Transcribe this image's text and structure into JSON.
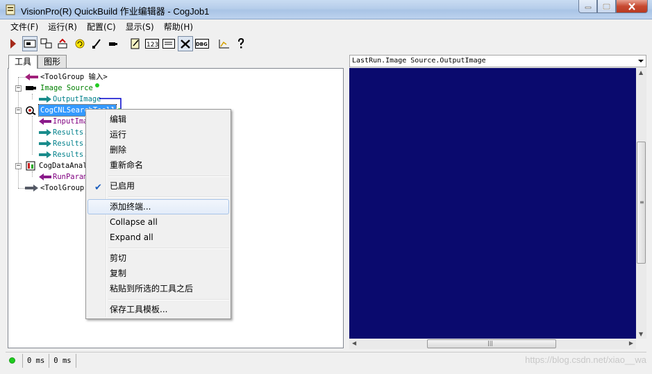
{
  "window": {
    "title": "VisionPro(R) QuickBuild 作业编辑器 - CogJob1"
  },
  "menu": [
    "文件(F)",
    "运行(R)",
    "配置(C)",
    "显示(S)",
    "帮助(H)"
  ],
  "toolbar": {
    "icons": [
      "run-icon",
      "show-display-icon",
      "swap-icon",
      "reset-icon",
      "loop-icon",
      "brush-icon",
      "camera-icon",
      "edit-icon",
      "numbers-icon",
      "image-icon",
      "tools-icon",
      "debug-icon",
      "graph-icon",
      "help-icon"
    ],
    "btn_123": "123",
    "btn_dbg": "DBG"
  },
  "tabs": [
    "工具",
    "图形"
  ],
  "tree": {
    "toolgroup_in": "<ToolGroup 输入>",
    "image_source": "Image Source",
    "output_image": "OutputImage",
    "cnl_search": "CogCNLSearchTool1",
    "input_image": "InputImage",
    "results1": "Results.",
    "results2": "Results.",
    "results3": "Results.",
    "data_analysis": "CogDataAnal",
    "run_params": "RunParam",
    "toolgroup_out": "<ToolGroup"
  },
  "display": {
    "combo_value": "LastRun.Image Source.OutputImage",
    "background": "#0a0a6e"
  },
  "context_menu": {
    "edit": "编辑",
    "run": "运行",
    "delete": "删除",
    "rename": "重新命名",
    "enabled": "已启用",
    "add_terminal": "添加终端...",
    "collapse_all": "Collapse all",
    "expand_all": "Expand all",
    "cut": "剪切",
    "copy": "复制",
    "paste_after": "粘贴到所选的工具之后",
    "save_template": "保存工具模板..."
  },
  "status": {
    "time1": "0 ms",
    "time2": "0 ms",
    "watermark": "https://blog.csdn.net/xiao__wa"
  }
}
